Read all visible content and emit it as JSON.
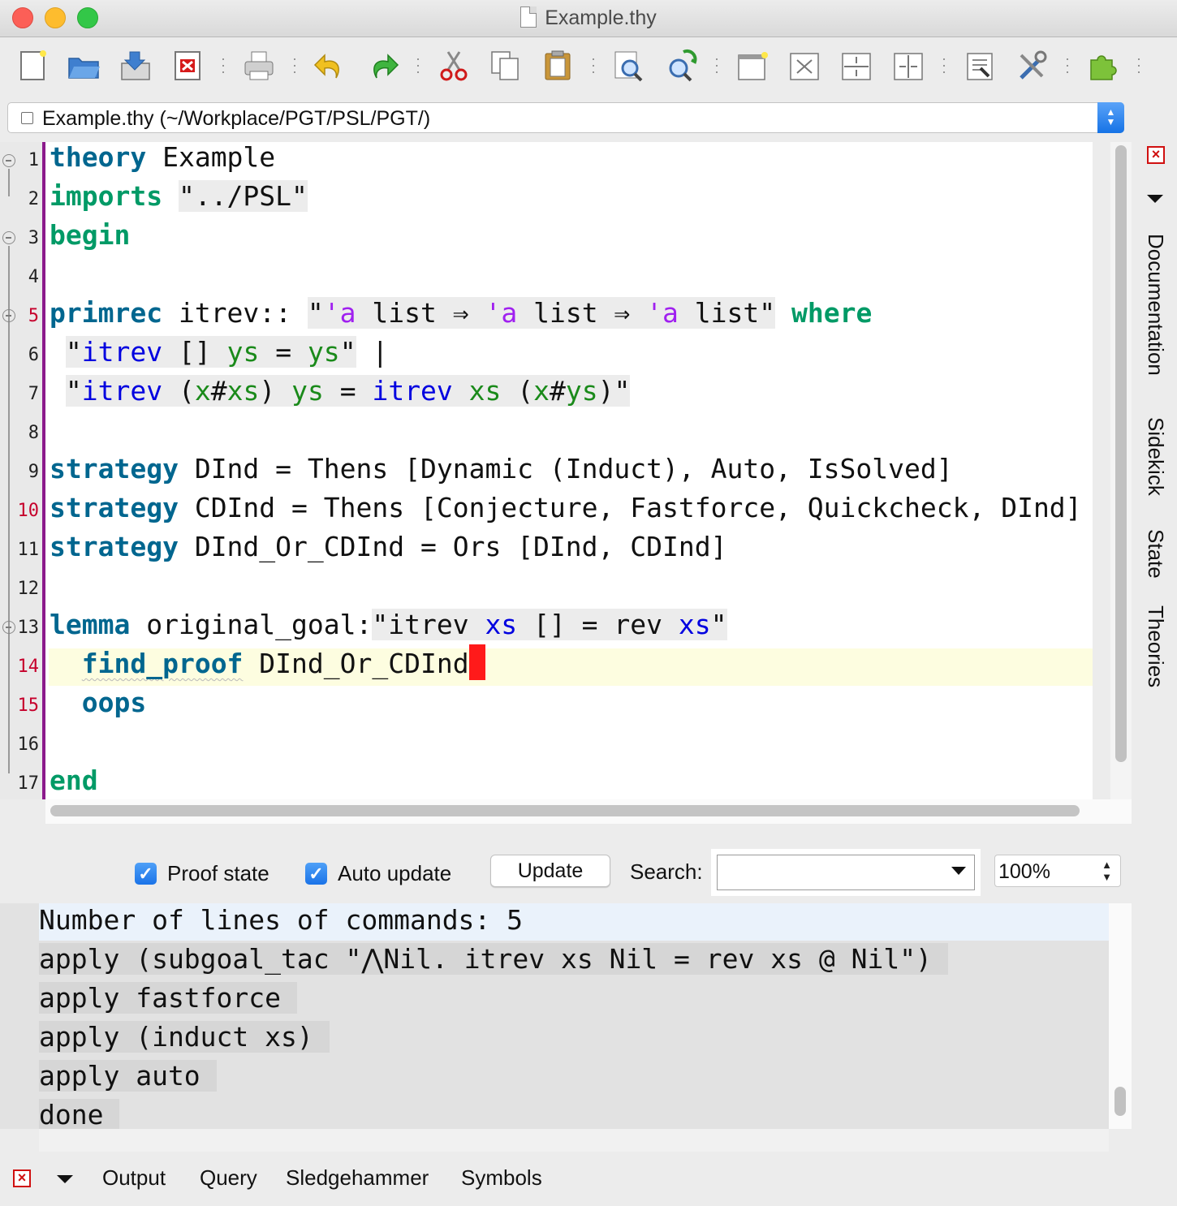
{
  "window": {
    "title": "Example.thy"
  },
  "toolbar": {
    "icons": [
      "new-file-icon",
      "open-file-icon",
      "save-file-icon",
      "close-file-icon",
      "print-icon",
      "undo-icon",
      "redo-icon",
      "cut-icon",
      "copy-icon",
      "paste-icon",
      "find-icon",
      "find-replace-icon",
      "new-view-icon",
      "unsplit-icon",
      "split-horizontal-icon",
      "split-vertical-icon",
      "settings-icon",
      "tools-icon",
      "plugins-icon"
    ]
  },
  "buffer": {
    "label": "Example.thy (~/Workplace/PGT/PSL/PGT/)"
  },
  "editor": {
    "line_numbers": [
      "1",
      "2",
      "3",
      "4",
      "5",
      "6",
      "7",
      "8",
      "9",
      "10",
      "11",
      "12",
      "13",
      "14",
      "15",
      "16",
      "17"
    ],
    "lines": {
      "l1": [
        "theory",
        " Example"
      ],
      "l2": [
        "imports",
        " ",
        "\"../PSL\""
      ],
      "l3": [
        "begin"
      ],
      "l5": [
        "primrec",
        " itrev:: ",
        "\"",
        "'a",
        " list ⇒ ",
        "'a",
        " list ⇒ ",
        "'a",
        " list\"",
        " ",
        "where"
      ],
      "l6": [
        " ",
        "\"",
        "itrev",
        " [] ",
        "ys",
        " = ",
        "ys",
        "\"",
        " |"
      ],
      "l7": [
        " ",
        "\"",
        "itrev",
        " (",
        "x",
        "#",
        "xs",
        ") ",
        "ys",
        " = ",
        "itrev",
        " ",
        "xs",
        " (",
        "x",
        "#",
        "ys",
        ")\""
      ],
      "l9": [
        "strategy",
        " DInd = Thens [Dynamic (Induct), Auto, IsSolved]"
      ],
      "l10": [
        "strategy",
        " CDInd = Thens [Conjecture, Fastforce, Quickcheck, DInd]"
      ],
      "l11": [
        "strategy",
        " DInd_Or_CDInd = Ors [DInd, CDInd]"
      ],
      "l13": [
        "lemma",
        " original_goal:",
        "\"itrev ",
        "xs",
        " [] = rev ",
        "xs",
        "\""
      ],
      "l14": [
        "  ",
        "find_proof",
        " DInd_Or_CDInd"
      ],
      "l15": [
        "  ",
        "oops"
      ],
      "l17": [
        "end"
      ]
    }
  },
  "output_controls": {
    "proof_state_label": "Proof state",
    "proof_state_checked": true,
    "auto_update_label": "Auto update",
    "auto_update_checked": true,
    "update_button": "Update",
    "search_label": "Search:",
    "search_value": "",
    "zoom_value": "100%"
  },
  "output": {
    "lines": [
      "Number of lines of commands: 5",
      "apply (subgoal_tac \"⋀Nil. itrev xs Nil = rev xs @ Nil\")",
      "apply fastforce",
      "apply (induct xs)",
      "apply auto",
      "done"
    ]
  },
  "bottom_dock": {
    "tabs": [
      "Output",
      "Query",
      "Sledgehammer",
      "Symbols"
    ]
  },
  "right_dock": {
    "tabs": [
      "Documentation",
      "Sidekick",
      "State",
      "Theories"
    ]
  },
  "colors": {
    "keyword_blue": "#00668f",
    "keyword_green": "#009a66",
    "type_var_purple": "#a020f0",
    "free_var_blue": "#0000e0",
    "bound_var_green": "#1a8a1a",
    "cursor_red": "#ff1a1a",
    "gutter_bar": "#8b1a8b"
  }
}
